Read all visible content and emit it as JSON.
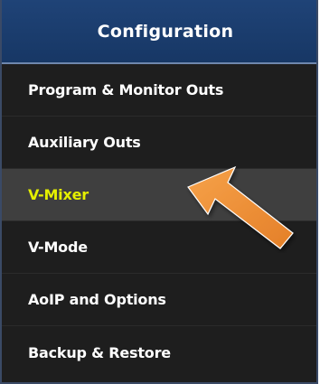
{
  "header": {
    "title": "Configuration"
  },
  "menu": {
    "items": [
      {
        "label": "Program & Monitor Outs",
        "active": false
      },
      {
        "label": "Auxiliary Outs",
        "active": false
      },
      {
        "label": "V-Mixer",
        "active": true
      },
      {
        "label": "V-Mode",
        "active": false
      },
      {
        "label": "AoIP and Options",
        "active": false
      },
      {
        "label": "Backup & Restore",
        "active": false
      }
    ]
  },
  "colors": {
    "header_bg": "#1b3c6e",
    "menu_bg": "#1e1e1e",
    "active_bg": "#3f3f3f",
    "active_text": "#e5f000",
    "text": "#ffffff",
    "arrow": "#f0923a"
  },
  "annotation": {
    "icon": "pointer-arrow-icon"
  }
}
